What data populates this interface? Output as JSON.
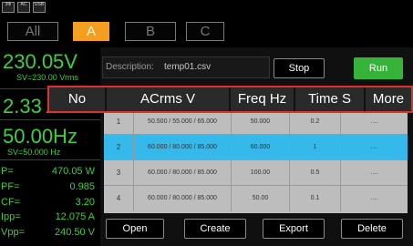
{
  "top_icons": [
    {
      "name": "phase-icon",
      "label": "3Φ"
    },
    {
      "name": "wave-icon",
      "label": "AC"
    },
    {
      "name": "usb-icon",
      "label": "USB"
    }
  ],
  "tabs": [
    "All",
    "A",
    "B",
    "C"
  ],
  "meters": {
    "voltage": "230.05V",
    "voltage_set": "SV=230.00 Vrms",
    "current": "2.33 A",
    "frequency": "50.00Hz",
    "frequency_set": "SV=50.000  Hz"
  },
  "params": [
    {
      "label": "P=",
      "value": "470.05 W"
    },
    {
      "label": "PF=",
      "value": "0.985"
    },
    {
      "label": "CF=",
      "value": "3.20"
    },
    {
      "label": "Ipp=",
      "value": "12.075 A"
    },
    {
      "label": "Vpp=",
      "value": "240.50 V"
    }
  ],
  "description": {
    "label": "Description:",
    "value": "temp01.csv"
  },
  "buttons": {
    "stop": "Stop",
    "run": "Run",
    "open": "Open",
    "create": "Create",
    "export": "Export",
    "delete": "Delete"
  },
  "header": [
    "No",
    "ACrms V",
    "Freq Hz",
    "Time S",
    "More"
  ],
  "rows": [
    {
      "no": "1",
      "acrms": "50.500 / 55.000 / 65.000",
      "freq": "50.000",
      "time": "0.2",
      "more": "...."
    },
    {
      "no": "2",
      "acrms": "60.000 / 80.000 / 85.000",
      "freq": "60.000",
      "time": "1",
      "more": "...."
    },
    {
      "no": "3",
      "acrms": "60.000 / 80.000 / 85.000",
      "freq": "100.00",
      "time": "0.5",
      "more": "...."
    },
    {
      "no": "4",
      "acrms": "60.000 / 80.000 / 85.000",
      "freq": "50.00",
      "time": "0.1",
      "more": "...."
    }
  ],
  "colors": {
    "accent": "#f59e1f",
    "readout": "#3cd13c",
    "selected_row": "#35b8ea",
    "run": "#36b43a",
    "highlight_border": "#e0302a"
  }
}
